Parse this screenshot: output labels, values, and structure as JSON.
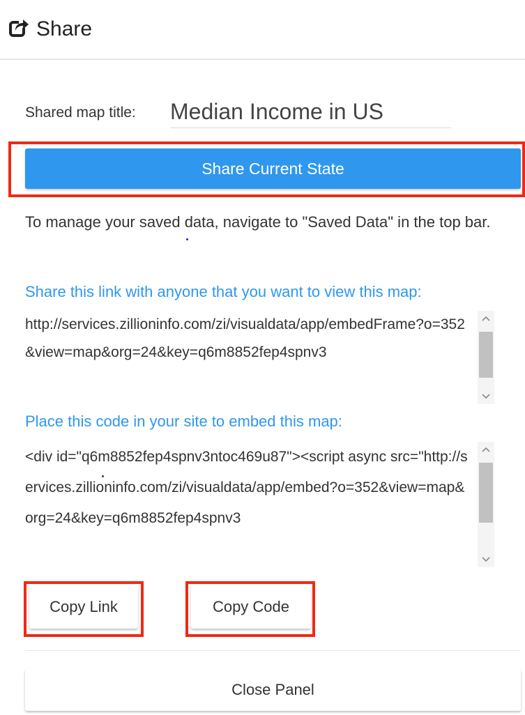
{
  "header": {
    "title": "Share",
    "icon": "share-icon"
  },
  "map_title": {
    "label": "Shared map title:",
    "value": "Median Income in US"
  },
  "share_button": {
    "label": "Share Current State"
  },
  "info": {
    "manage_text": "To manage your saved data, navigate to \"Saved Data\" in the top bar."
  },
  "link_section": {
    "label": "Share this link with anyone that you want to view this map:",
    "value": "http://services.zillioninfo.com/zi/visualdata/app/embedFrame?o=352&view=map&org=24&key=q6m8852fep4spnv3"
  },
  "code_section": {
    "label": "Place this code in your site to embed this map:",
    "value": "<div id=\"q6m8852fep4spnv3ntoc469u87\"><script async src=\"http://services.zillioninfo.com/zi/visualdata/app/embed?o=352&view=map&org=24&key=q6m8852fep4spnv3"
  },
  "buttons": {
    "copy_link": "Copy Link",
    "copy_code": "Copy Code",
    "close": "Close Panel"
  },
  "colors": {
    "accent": "#2f97ee",
    "highlight": "#ee2a16"
  }
}
